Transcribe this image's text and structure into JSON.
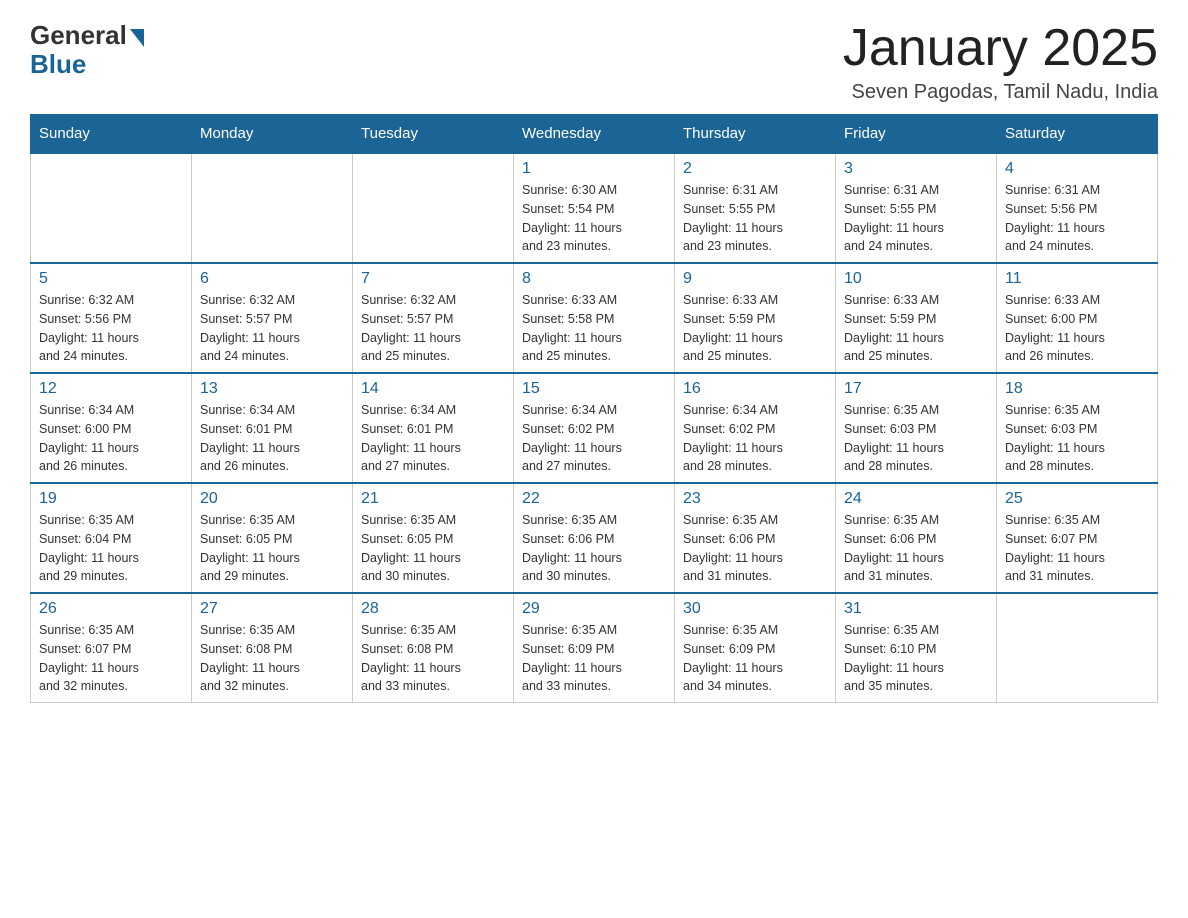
{
  "logo": {
    "general": "General",
    "blue": "Blue"
  },
  "title": "January 2025",
  "subtitle": "Seven Pagodas, Tamil Nadu, India",
  "weekdays": [
    "Sunday",
    "Monday",
    "Tuesday",
    "Wednesday",
    "Thursday",
    "Friday",
    "Saturday"
  ],
  "weeks": [
    [
      {
        "day": "",
        "info": ""
      },
      {
        "day": "",
        "info": ""
      },
      {
        "day": "",
        "info": ""
      },
      {
        "day": "1",
        "info": "Sunrise: 6:30 AM\nSunset: 5:54 PM\nDaylight: 11 hours\nand 23 minutes."
      },
      {
        "day": "2",
        "info": "Sunrise: 6:31 AM\nSunset: 5:55 PM\nDaylight: 11 hours\nand 23 minutes."
      },
      {
        "day": "3",
        "info": "Sunrise: 6:31 AM\nSunset: 5:55 PM\nDaylight: 11 hours\nand 24 minutes."
      },
      {
        "day": "4",
        "info": "Sunrise: 6:31 AM\nSunset: 5:56 PM\nDaylight: 11 hours\nand 24 minutes."
      }
    ],
    [
      {
        "day": "5",
        "info": "Sunrise: 6:32 AM\nSunset: 5:56 PM\nDaylight: 11 hours\nand 24 minutes."
      },
      {
        "day": "6",
        "info": "Sunrise: 6:32 AM\nSunset: 5:57 PM\nDaylight: 11 hours\nand 24 minutes."
      },
      {
        "day": "7",
        "info": "Sunrise: 6:32 AM\nSunset: 5:57 PM\nDaylight: 11 hours\nand 25 minutes."
      },
      {
        "day": "8",
        "info": "Sunrise: 6:33 AM\nSunset: 5:58 PM\nDaylight: 11 hours\nand 25 minutes."
      },
      {
        "day": "9",
        "info": "Sunrise: 6:33 AM\nSunset: 5:59 PM\nDaylight: 11 hours\nand 25 minutes."
      },
      {
        "day": "10",
        "info": "Sunrise: 6:33 AM\nSunset: 5:59 PM\nDaylight: 11 hours\nand 25 minutes."
      },
      {
        "day": "11",
        "info": "Sunrise: 6:33 AM\nSunset: 6:00 PM\nDaylight: 11 hours\nand 26 minutes."
      }
    ],
    [
      {
        "day": "12",
        "info": "Sunrise: 6:34 AM\nSunset: 6:00 PM\nDaylight: 11 hours\nand 26 minutes."
      },
      {
        "day": "13",
        "info": "Sunrise: 6:34 AM\nSunset: 6:01 PM\nDaylight: 11 hours\nand 26 minutes."
      },
      {
        "day": "14",
        "info": "Sunrise: 6:34 AM\nSunset: 6:01 PM\nDaylight: 11 hours\nand 27 minutes."
      },
      {
        "day": "15",
        "info": "Sunrise: 6:34 AM\nSunset: 6:02 PM\nDaylight: 11 hours\nand 27 minutes."
      },
      {
        "day": "16",
        "info": "Sunrise: 6:34 AM\nSunset: 6:02 PM\nDaylight: 11 hours\nand 28 minutes."
      },
      {
        "day": "17",
        "info": "Sunrise: 6:35 AM\nSunset: 6:03 PM\nDaylight: 11 hours\nand 28 minutes."
      },
      {
        "day": "18",
        "info": "Sunrise: 6:35 AM\nSunset: 6:03 PM\nDaylight: 11 hours\nand 28 minutes."
      }
    ],
    [
      {
        "day": "19",
        "info": "Sunrise: 6:35 AM\nSunset: 6:04 PM\nDaylight: 11 hours\nand 29 minutes."
      },
      {
        "day": "20",
        "info": "Sunrise: 6:35 AM\nSunset: 6:05 PM\nDaylight: 11 hours\nand 29 minutes."
      },
      {
        "day": "21",
        "info": "Sunrise: 6:35 AM\nSunset: 6:05 PM\nDaylight: 11 hours\nand 30 minutes."
      },
      {
        "day": "22",
        "info": "Sunrise: 6:35 AM\nSunset: 6:06 PM\nDaylight: 11 hours\nand 30 minutes."
      },
      {
        "day": "23",
        "info": "Sunrise: 6:35 AM\nSunset: 6:06 PM\nDaylight: 11 hours\nand 31 minutes."
      },
      {
        "day": "24",
        "info": "Sunrise: 6:35 AM\nSunset: 6:06 PM\nDaylight: 11 hours\nand 31 minutes."
      },
      {
        "day": "25",
        "info": "Sunrise: 6:35 AM\nSunset: 6:07 PM\nDaylight: 11 hours\nand 31 minutes."
      }
    ],
    [
      {
        "day": "26",
        "info": "Sunrise: 6:35 AM\nSunset: 6:07 PM\nDaylight: 11 hours\nand 32 minutes."
      },
      {
        "day": "27",
        "info": "Sunrise: 6:35 AM\nSunset: 6:08 PM\nDaylight: 11 hours\nand 32 minutes."
      },
      {
        "day": "28",
        "info": "Sunrise: 6:35 AM\nSunset: 6:08 PM\nDaylight: 11 hours\nand 33 minutes."
      },
      {
        "day": "29",
        "info": "Sunrise: 6:35 AM\nSunset: 6:09 PM\nDaylight: 11 hours\nand 33 minutes."
      },
      {
        "day": "30",
        "info": "Sunrise: 6:35 AM\nSunset: 6:09 PM\nDaylight: 11 hours\nand 34 minutes."
      },
      {
        "day": "31",
        "info": "Sunrise: 6:35 AM\nSunset: 6:10 PM\nDaylight: 11 hours\nand 35 minutes."
      },
      {
        "day": "",
        "info": ""
      }
    ]
  ]
}
